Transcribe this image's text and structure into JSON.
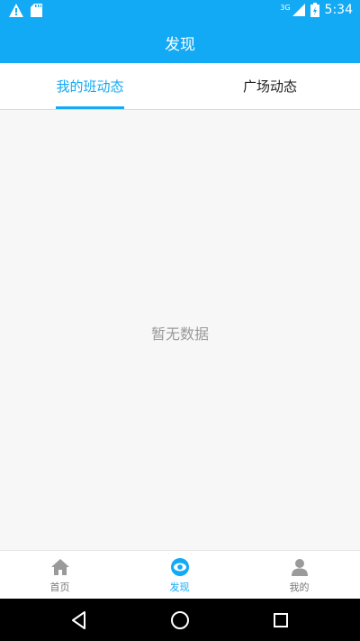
{
  "status_bar": {
    "time": "5:34",
    "network_label": "3G",
    "icons": [
      "warning-icon",
      "sd-card-icon",
      "signal-icon",
      "battery-icon"
    ]
  },
  "header": {
    "title": "发现"
  },
  "tabs": [
    {
      "label": "我的班动态",
      "active": true
    },
    {
      "label": "广场动态",
      "active": false
    }
  ],
  "content": {
    "empty_message": "暂无数据"
  },
  "bottom_nav": {
    "items": [
      {
        "label": "首页",
        "icon": "home-icon",
        "active": false
      },
      {
        "label": "发现",
        "icon": "eye-icon",
        "active": true
      },
      {
        "label": "我的",
        "icon": "person-icon",
        "active": false
      }
    ]
  },
  "colors": {
    "accent": "#12a9f5",
    "inactive": "#9a9a9a"
  }
}
